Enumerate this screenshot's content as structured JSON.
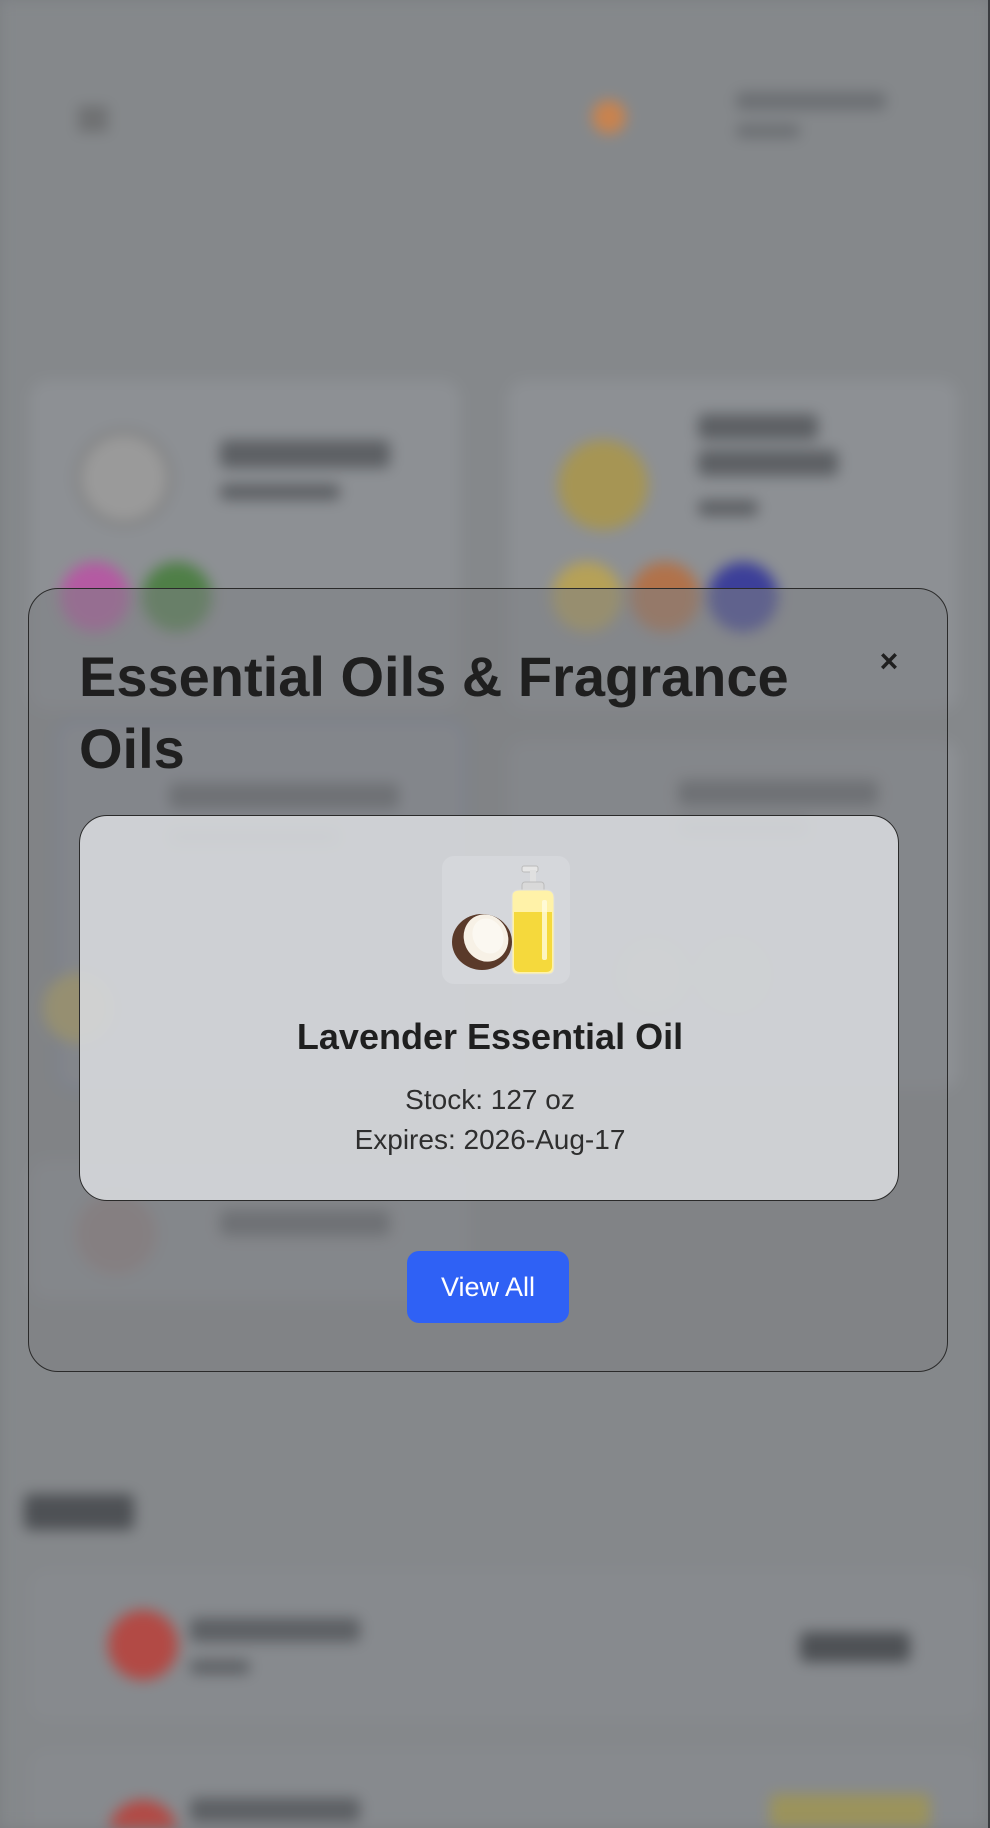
{
  "modal": {
    "title": "Essential Oils & Fragrance Oils",
    "close_label": "×",
    "item": {
      "name": "Lavender Essential Oil",
      "stock": "Stock: 127 oz",
      "expires": "Expires: 2026-Aug-17",
      "image_icon": "coconut-oil-bottle-icon"
    },
    "view_all_label": "View All"
  },
  "colors": {
    "primary_button": "#2f61f5",
    "overlay": "#7c7f83"
  }
}
